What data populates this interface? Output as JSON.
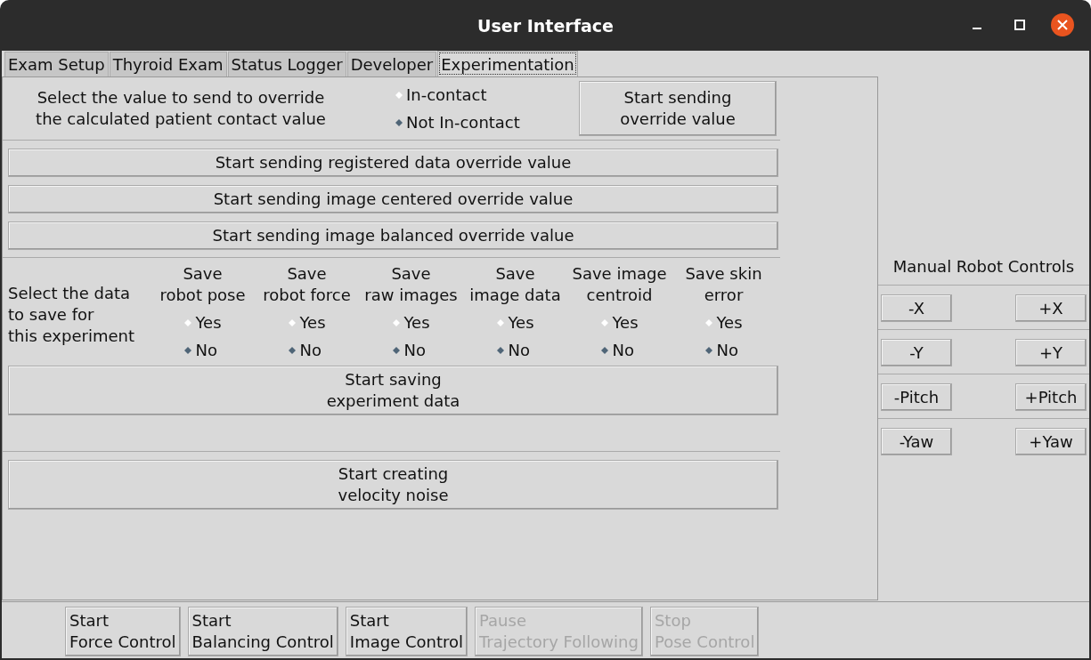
{
  "window": {
    "title": "User Interface"
  },
  "tabs": [
    {
      "label": "Exam Setup",
      "selected": false
    },
    {
      "label": "Thyroid Exam",
      "selected": false
    },
    {
      "label": "Status Logger",
      "selected": false
    },
    {
      "label": "Developer",
      "selected": false
    },
    {
      "label": "Experimentation",
      "selected": true
    }
  ],
  "contact_override": {
    "prompt": "Select the value to send to override\nthe calculated patient contact value",
    "options": [
      {
        "label": "In-contact",
        "selected": false
      },
      {
        "label": "Not In-contact",
        "selected": true
      }
    ],
    "button": "Start sending\noverride value"
  },
  "override_buttons": [
    "Start sending registered data override value",
    "Start sending image centered override value",
    "Start sending image balanced override value"
  ],
  "save_data": {
    "prompt": "Select the data\nto save for\nthis experiment",
    "columns": [
      {
        "heading": "Save\nrobot pose",
        "options": [
          {
            "label": "Yes",
            "selected": false
          },
          {
            "label": "No",
            "selected": true
          }
        ]
      },
      {
        "heading": "Save\nrobot force",
        "options": [
          {
            "label": "Yes",
            "selected": false
          },
          {
            "label": "No",
            "selected": true
          }
        ]
      },
      {
        "heading": "Save\nraw images",
        "options": [
          {
            "label": "Yes",
            "selected": false
          },
          {
            "label": "No",
            "selected": true
          }
        ]
      },
      {
        "heading": "Save\nimage data",
        "options": [
          {
            "label": "Yes",
            "selected": false
          },
          {
            "label": "No",
            "selected": true
          }
        ]
      },
      {
        "heading": "Save image\ncentroid",
        "options": [
          {
            "label": "Yes",
            "selected": false
          },
          {
            "label": "No",
            "selected": true
          }
        ]
      },
      {
        "heading": "Save skin\nerror",
        "options": [
          {
            "label": "Yes",
            "selected": false
          },
          {
            "label": "No",
            "selected": true
          }
        ]
      }
    ],
    "button": "Start saving\nexperiment data"
  },
  "noise_button": "Start creating\nvelocity noise",
  "manual_controls": {
    "title": "Manual Robot Controls",
    "rows": [
      [
        "-X",
        "+X"
      ],
      [
        "-Y",
        "+Y"
      ],
      [
        "-Pitch",
        "+Pitch"
      ],
      [
        "-Yaw",
        "+Yaw"
      ]
    ]
  },
  "bottom_buttons": [
    {
      "label": "Start\nForce Control",
      "disabled": false
    },
    {
      "label": "Start\nBalancing Control",
      "disabled": false
    },
    {
      "label": "Start\nImage Control",
      "disabled": false
    },
    {
      "label": "Pause\nTrajectory Following",
      "disabled": true
    },
    {
      "label": "Stop\nPose Control",
      "disabled": true
    }
  ]
}
